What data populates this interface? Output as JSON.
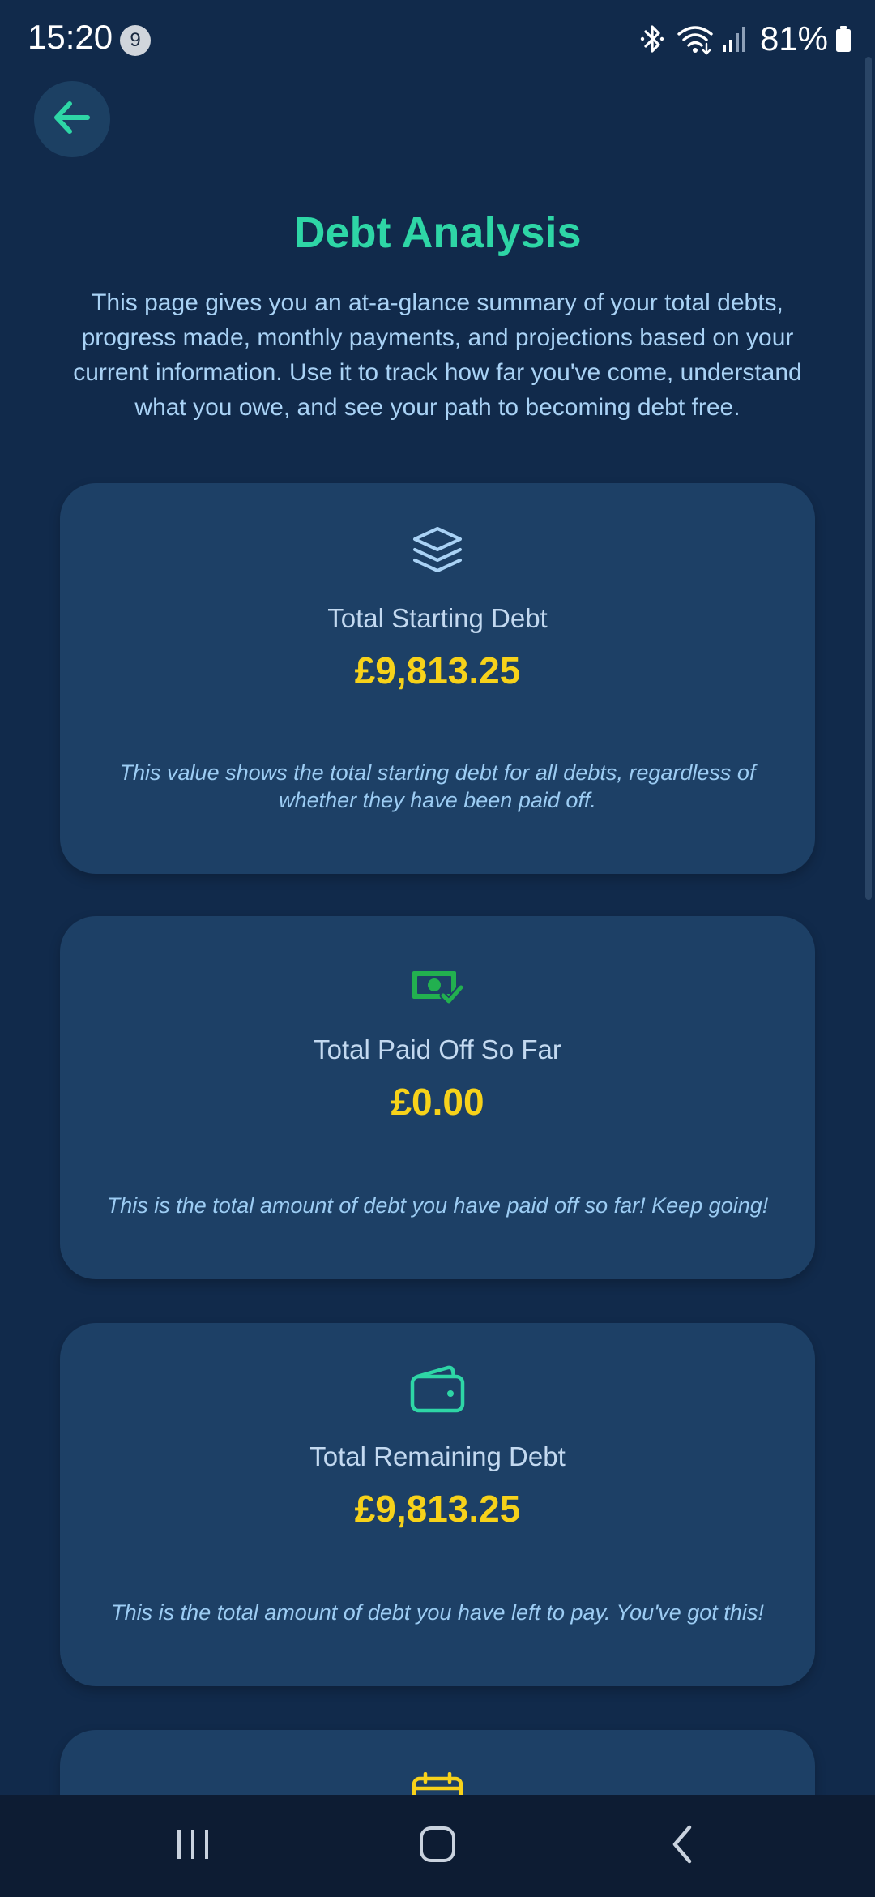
{
  "status_bar": {
    "time": "15:20",
    "notification_count": "9",
    "battery": "81%"
  },
  "page": {
    "title": "Debt Analysis",
    "description": "This page gives you an at-a-glance summary of your total debts, progress made, monthly payments, and projections based on your current information. Use it to track how far you've come, understand what you owe, and see your path to becoming debt free."
  },
  "cards": [
    {
      "icon": "layers-icon",
      "title": "Total Starting Debt",
      "value": "£9,813.25",
      "note": "This value shows the total starting debt for all debts, regardless of whether they have been paid off."
    },
    {
      "icon": "cash-check-icon",
      "title": "Total Paid Off So Far",
      "value": "£0.00",
      "note": "This is the total amount of debt you have paid off so far! Keep going!"
    },
    {
      "icon": "wallet-icon",
      "title": "Total Remaining Debt",
      "value": "£9,813.25",
      "note": "This is the total amount of debt you have left to pay. You've got this!"
    },
    {
      "icon": "calendar-icon"
    }
  ],
  "colors": {
    "background": "#112a4b",
    "card": "#1d4066",
    "accent": "#2ed6a6",
    "value": "#f7d21a",
    "text_muted": "#9cccf3"
  }
}
